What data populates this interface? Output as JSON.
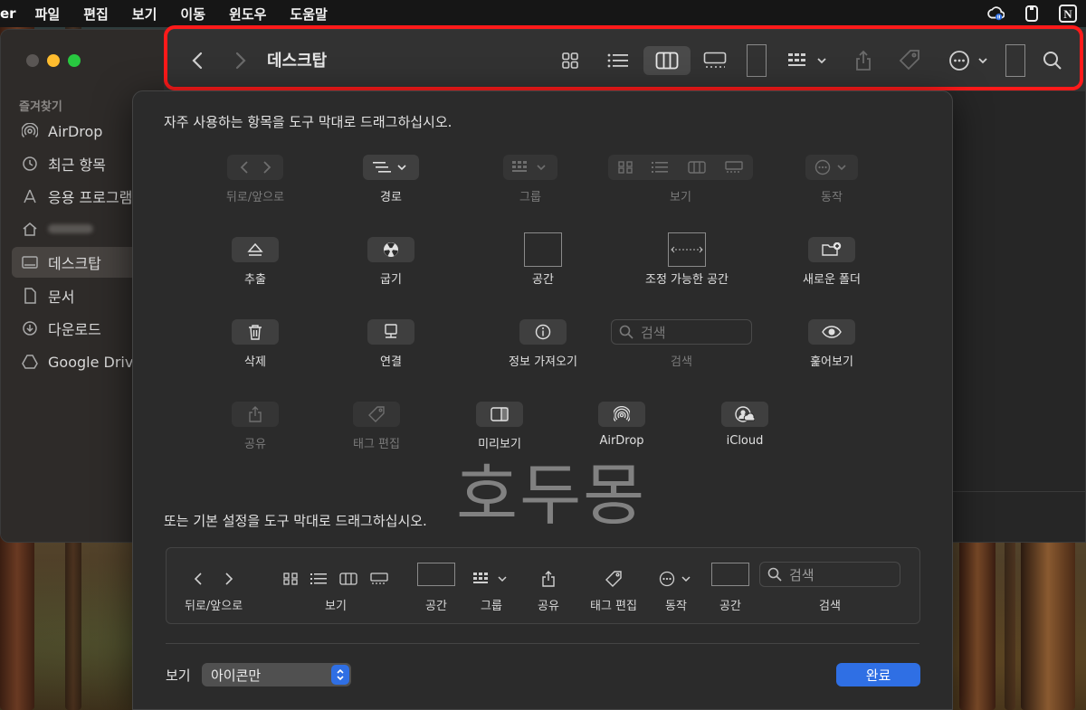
{
  "menubar": {
    "app_name": "er",
    "items": [
      "파일",
      "편집",
      "보기",
      "이동",
      "윈도우",
      "도움말"
    ],
    "status_icons": [
      "creative-cloud-icon",
      "clipboard-icon",
      "notion-icon"
    ],
    "notion_letter": "N"
  },
  "finder": {
    "title": "데스크탑",
    "sidebar": {
      "section": "즐겨찾기",
      "items": [
        {
          "label": "AirDrop",
          "icon": "airdrop-icon"
        },
        {
          "label": "최근 항목",
          "icon": "clock-icon"
        },
        {
          "label": "응용 프로그램",
          "icon": "applications-icon"
        },
        {
          "label": "",
          "icon": "home-icon"
        },
        {
          "label": "데스크탑",
          "icon": "desktop-icon",
          "selected": true
        },
        {
          "label": "문서",
          "icon": "document-icon"
        },
        {
          "label": "다운로드",
          "icon": "download-icon"
        },
        {
          "label": "Google Drive",
          "icon": "google-drive-icon"
        }
      ]
    }
  },
  "sheet": {
    "heading": "자주 사용하는 항목을 도구 막대로 드래그하십시오.",
    "items": {
      "back_forward": "뒤로/앞으로",
      "path": "경로",
      "group": "그룹",
      "view": "보기",
      "action": "동작",
      "eject": "추출",
      "burn": "굽기",
      "space": "공간",
      "flexible_space": "조정 가능한 공간",
      "new_folder": "새로운 폴더",
      "delete": "삭제",
      "connect": "연결",
      "get_info": "정보 가져오기",
      "search": "검색",
      "search_placeholder": "검색",
      "quick_look": "훑어보기",
      "share": "공유",
      "edit_tags": "태그 편집",
      "preview": "미리보기",
      "airdrop": "AirDrop",
      "icloud": "iCloud"
    },
    "default_heading": "또는 기본 설정을 도구 막대로 드래그하십시오.",
    "default_set": {
      "back_forward": "뒤로/앞으로",
      "view": "보기",
      "space1": "공간",
      "group": "그룹",
      "share": "공유",
      "edit_tags": "태그 편집",
      "action": "동작",
      "space2": "공간",
      "search": "검색",
      "search_placeholder": "검색"
    },
    "show_label": "보기",
    "show_value": "아이콘만",
    "done": "완료"
  },
  "watermark": "호두몽",
  "colors": {
    "highlight": "#ff1a1a",
    "accent": "#2f6fe4",
    "close": "#ff5f57",
    "minimize": "#febc2e",
    "zoom": "#28c840"
  }
}
